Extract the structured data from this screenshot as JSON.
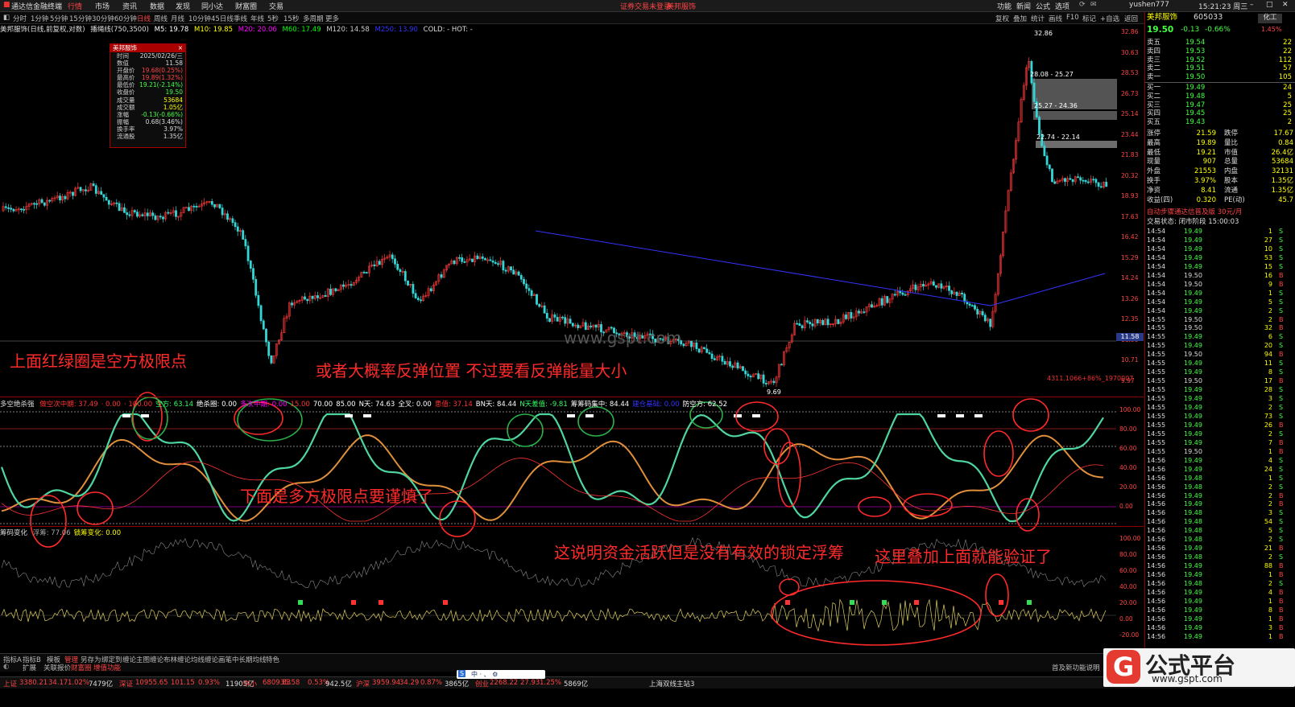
{
  "titlebar": {
    "app_name": "通达信金融终端",
    "menus": [
      "行情",
      "市场",
      "资讯",
      "数据",
      "发现",
      "同小达",
      "财富圈",
      "交易"
    ],
    "center_notice": "证券交易未登录",
    "center_stock": "美邦服饰",
    "right_items": [
      "功能",
      "新闻",
      "公式",
      "选项"
    ],
    "user": "yushen777",
    "time": "15:21:23 周三"
  },
  "periodbar": {
    "items": [
      "分时",
      "1分钟",
      "5分钟",
      "15分钟",
      "30分钟",
      "60分钟",
      "日线",
      "周线",
      "月线",
      "10分钟",
      "45日线",
      "季线",
      "年线",
      "5秒",
      "15秒",
      "多周期",
      "更多"
    ],
    "active": "日线",
    "right_items": [
      "复权",
      "叠加",
      "统计",
      "画线",
      "F10",
      "标记",
      "+自选",
      "返回"
    ]
  },
  "main_legend": {
    "stock": "美邦服饰(日线,前复权,对数)",
    "indicator": "播绳线(750,3500)",
    "ma": [
      {
        "label": "M5: 19.78",
        "color": "#ffffff"
      },
      {
        "label": "M10: 19.85",
        "color": "#ffff00"
      },
      {
        "label": "M20: 20.06",
        "color": "#ff00ff"
      },
      {
        "label": "M60: 17.49",
        "color": "#00ff00"
      },
      {
        "label": "M120: 14.58",
        "color": "#cccccc"
      },
      {
        "label": "M250: 13.90",
        "color": "#3333ff"
      }
    ],
    "extra": "COLD: - HOT: -"
  },
  "infobox": {
    "title": "美邦服饰",
    "rows": [
      {
        "k": "时间",
        "v": "2025/02/26/三"
      },
      {
        "k": "数值",
        "v": "11.58"
      },
      {
        "k": "开盘价",
        "v": "19.68(0.25%)",
        "c": "#ff4444"
      },
      {
        "k": "最高价",
        "v": "19.89(1.32%)",
        "c": "#ff4444"
      },
      {
        "k": "最低价",
        "v": "19.21(-2.14%)",
        "c": "#44ff44"
      },
      {
        "k": "收盘价",
        "v": "19.50",
        "c": "#44ff44"
      },
      {
        "k": "成交量",
        "v": "53684",
        "c": "#ffff00"
      },
      {
        "k": "成交额",
        "v": "1.05亿",
        "c": "#ffff00"
      },
      {
        "k": "涨幅",
        "v": "-0.13(-0.66%)",
        "c": "#44ff44"
      },
      {
        "k": "振幅",
        "v": "0.68(3.46%)"
      },
      {
        "k": "换手率",
        "v": "3.97%"
      },
      {
        "k": "流通股",
        "v": "1.35亿"
      }
    ]
  },
  "chart_labels": {
    "peak": "32.86",
    "gap1": "28.08 - 25.27",
    "gap2": "25.27 - 24.36",
    "gap3": "22.74 - 22.14",
    "low": "9.69",
    "price_line": "11.58",
    "right_note": "4311.1066+86%_1970007"
  },
  "price_axis": [
    "32.86",
    "30.63",
    "28.53",
    "26.73",
    "25.14",
    "23.44",
    "21.83",
    "20.32",
    "18.93",
    "17.63",
    "16.42",
    "15.29",
    "14.24",
    "13.26",
    "12.35",
    "11.50",
    "10.71",
    "9.97"
  ],
  "indicator1": {
    "name": "多空绝杀强",
    "items": [
      {
        "t": "做空次中期: 37.49",
        "c": "#ff3333"
      },
      {
        "t": "· 0.00",
        "c": "#ff3333"
      },
      {
        "t": "· 100.00",
        "c": "#ff3333"
      },
      {
        "t": "空方: 63.14",
        "c": "#33ff66"
      },
      {
        "t": "绝杀圈: 0.00",
        "c": "#ffffff"
      },
      {
        "t": "多次中期: 0.00",
        "c": "#ff00ff"
      },
      {
        "t": "15.00",
        "c": "#ff3333"
      },
      {
        "t": "70.00",
        "c": "#ffffff"
      },
      {
        "t": "85.00",
        "c": "#ffffff"
      },
      {
        "t": "N天: 74.63",
        "c": "#ffffff"
      },
      {
        "t": "全叉: 0.00",
        "c": "#ffffff"
      },
      {
        "t": "患值: 37.14",
        "c": "#ff3333"
      },
      {
        "t": "BN天: 84.44",
        "c": "#ffffff"
      },
      {
        "t": "N天差值: -9.81",
        "c": "#33ff66"
      },
      {
        "t": "筹筹码集中: 84.44",
        "c": "#ffffff"
      },
      {
        "t": "建仓基础: 0.00",
        "c": "#3333ff"
      },
      {
        "t": "防空方: 62.52",
        "c": "#ffffff"
      }
    ],
    "axis": [
      "100.00",
      "80.00",
      "60.00",
      "40.00",
      "20.00",
      "0.00"
    ]
  },
  "indicator2": {
    "name": "筹码变化",
    "items": [
      {
        "t": "浮筹: 77.06",
        "c": "#aaaaaa"
      },
      {
        "t": "锁筹变化: 0.00",
        "c": "#ffff00"
      }
    ],
    "axis": [
      "100.00",
      "80.00",
      "60.00",
      "40.00",
      "20.00",
      "0.00",
      "-20.00"
    ]
  },
  "annotations": [
    "上面红绿圈是空方极限点",
    "或者大概率反弹位置 不过要看反弹能量大小",
    "下面是多方极限点要谨慎了",
    "这说明资金活跃但是没有有效的锁定浮筹",
    "这里叠加上面就能验证了"
  ],
  "watermark": "www.gspt.com",
  "quote": {
    "name": "美邦服饰",
    "code": "605033",
    "price": "19.50",
    "change": "-0.13",
    "pct": "-0.66%",
    "badge": "化工",
    "badge_pct": "1.45%",
    "asks": [
      {
        "l": "卖五",
        "p": "19.54",
        "v": "22"
      },
      {
        "l": "卖四",
        "p": "19.53",
        "v": "22"
      },
      {
        "l": "卖三",
        "p": "19.52",
        "v": "112"
      },
      {
        "l": "卖二",
        "p": "19.51",
        "v": "57"
      },
      {
        "l": "卖一",
        "p": "19.50",
        "v": "105"
      }
    ],
    "bids": [
      {
        "l": "买一",
        "p": "19.49",
        "v": "24"
      },
      {
        "l": "买二",
        "p": "19.48",
        "v": "5"
      },
      {
        "l": "买三",
        "p": "19.47",
        "v": "25"
      },
      {
        "l": "买四",
        "p": "19.45",
        "v": "25"
      },
      {
        "l": "买五",
        "p": "19.43",
        "v": "2"
      }
    ],
    "stats": [
      {
        "a": "涨停",
        "av": "21.59",
        "b": "跌停",
        "bv": "17.67"
      },
      {
        "a": "最高",
        "av": "19.89",
        "b": "量比",
        "bv": "0.84"
      },
      {
        "a": "最低",
        "av": "19.21",
        "b": "市值",
        "bv": "26.4亿"
      },
      {
        "a": "现量",
        "av": "907",
        "b": "总量",
        "bv": "53684"
      },
      {
        "a": "外盘",
        "av": "21553",
        "b": "内盘",
        "bv": "32131"
      },
      {
        "a": "换手",
        "av": "3.97%",
        "b": "股本",
        "bv": "1.35亿"
      },
      {
        "a": "净资",
        "av": "8.41",
        "b": "流通",
        "bv": "1.35亿"
      },
      {
        "a": "收益(四)",
        "av": "0.320",
        "b": "PE(动)",
        "bv": "45.7"
      }
    ],
    "notice": "自动步骤通达信普及版 30元/月",
    "trade_status": "交易状态: 闭市阶段 15:00:03"
  },
  "ticks": [
    [
      "14:54",
      "19.49",
      "1",
      "S"
    ],
    [
      "14:54",
      "19.49",
      "27",
      "S"
    ],
    [
      "14:54",
      "19.49",
      "10",
      "S"
    ],
    [
      "14:54",
      "19.49",
      "53",
      "S"
    ],
    [
      "14:54",
      "19.49",
      "15",
      "S"
    ],
    [
      "14:54",
      "19.50",
      "16",
      "B"
    ],
    [
      "14:54",
      "19.50",
      "9",
      "B"
    ],
    [
      "14:54",
      "19.49",
      "1",
      "S"
    ],
    [
      "14:54",
      "19.49",
      "5",
      "S"
    ],
    [
      "14:54",
      "19.49",
      "2",
      "S"
    ],
    [
      "14:55",
      "19.50",
      "2",
      "B"
    ],
    [
      "14:55",
      "19.50",
      "32",
      "B"
    ],
    [
      "14:55",
      "19.49",
      "6",
      "S"
    ],
    [
      "14:55",
      "19.49",
      "20",
      "S"
    ],
    [
      "14:55",
      "19.50",
      "94",
      "B"
    ],
    [
      "14:55",
      "19.49",
      "11",
      "S"
    ],
    [
      "14:55",
      "19.49",
      "8",
      "S"
    ],
    [
      "14:55",
      "19.50",
      "17",
      "B"
    ],
    [
      "14:55",
      "19.49",
      "28",
      "S"
    ],
    [
      "14:55",
      "19.49",
      "3",
      "S"
    ],
    [
      "14:55",
      "19.49",
      "2",
      "S"
    ],
    [
      "14:55",
      "19.49",
      "73",
      "S"
    ],
    [
      "14:55",
      "19.49",
      "26",
      "B"
    ],
    [
      "14:55",
      "19.49",
      "2",
      "S"
    ],
    [
      "14:55",
      "19.49",
      "7",
      "B"
    ],
    [
      "14:55",
      "19.50",
      "1",
      "B"
    ],
    [
      "14:56",
      "19.49",
      "4",
      "S"
    ],
    [
      "14:56",
      "19.49",
      "24",
      "S"
    ],
    [
      "14:56",
      "19.48",
      "1",
      "S"
    ],
    [
      "14:56",
      "19.48",
      "2",
      "S"
    ],
    [
      "14:56",
      "19.49",
      "2",
      "B"
    ],
    [
      "14:56",
      "19.49",
      "2",
      "B"
    ],
    [
      "14:56",
      "19.48",
      "3",
      "S"
    ],
    [
      "14:56",
      "19.48",
      "54",
      "S"
    ],
    [
      "14:56",
      "19.48",
      "5",
      "S"
    ],
    [
      "14:56",
      "19.48",
      "2",
      "S"
    ],
    [
      "14:56",
      "19.49",
      "21",
      "B"
    ],
    [
      "14:56",
      "19.48",
      "2",
      "S"
    ],
    [
      "14:56",
      "19.49",
      "88",
      "B"
    ],
    [
      "14:56",
      "19.49",
      "1",
      "B"
    ],
    [
      "14:56",
      "19.48",
      "2",
      "S"
    ],
    [
      "14:56",
      "19.49",
      "4",
      "B"
    ],
    [
      "14:56",
      "19.49",
      "1",
      "B"
    ],
    [
      "14:56",
      "19.49",
      "8",
      "B"
    ],
    [
      "14:56",
      "19.49",
      "1",
      "B"
    ],
    [
      "14:56",
      "19.49",
      "3",
      "B"
    ],
    [
      "14:56",
      "19.49",
      "1",
      "B"
    ]
  ],
  "bottombar": {
    "tabs_row1": [
      "指标A",
      "指标B",
      "模板",
      "管理",
      "另存为",
      "绑定到",
      "缠论主图",
      "缠论布林",
      "缠论均线",
      "缠论画笔",
      "中长期均线",
      "特色"
    ],
    "tabs_row2": [
      "扩展",
      "关联报价",
      "财富圈",
      "增值功能"
    ],
    "right_text": "首及新功能说明"
  },
  "statusbar": {
    "items": [
      {
        "t": "上证",
        "c": "#ff4444"
      },
      {
        "t": "3380.21",
        "c": "#ff4444"
      },
      {
        "t": "34.17",
        "c": "#ff4444"
      },
      {
        "t": "1.02%",
        "c": "#ff4444"
      },
      {
        "t": "7479亿",
        "c": "#dddddd"
      },
      {
        "t": "深证",
        "c": "#ff4444"
      },
      {
        "t": "10955.65",
        "c": "#ff4444"
      },
      {
        "t": "101.15",
        "c": "#ff4444"
      },
      {
        "t": "0.93%",
        "c": "#ff4444"
      },
      {
        "t": "11905亿",
        "c": "#dddddd"
      },
      {
        "t": "中小",
        "c": "#ff4444"
      },
      {
        "t": "6809.83",
        "c": "#ff4444"
      },
      {
        "t": "35.58",
        "c": "#ff4444"
      },
      {
        "t": "0.53%",
        "c": "#ff4444"
      },
      {
        "t": "942.5亿",
        "c": "#dddddd"
      },
      {
        "t": "沪深",
        "c": "#ff4444"
      },
      {
        "t": "3959.94",
        "c": "#ff4444"
      },
      {
        "t": "34.29",
        "c": "#ff4444"
      },
      {
        "t": "0.87%",
        "c": "#ff4444"
      },
      {
        "t": "3865亿",
        "c": "#dddddd"
      },
      {
        "t": "创业",
        "c": "#ff4444"
      },
      {
        "t": "2268.22",
        "c": "#ff4444"
      },
      {
        "t": "27.93",
        "c": "#ff4444"
      },
      {
        "t": "1.25%",
        "c": "#ff4444"
      },
      {
        "t": "5869亿",
        "c": "#dddddd"
      },
      {
        "t": "上海双线主站3",
        "c": "#dddddd"
      }
    ]
  },
  "logo": {
    "brand": "公式平台",
    "url": "www.gspt.com",
    "glyph": "G"
  },
  "ime": "中 · 、 ⚙"
}
